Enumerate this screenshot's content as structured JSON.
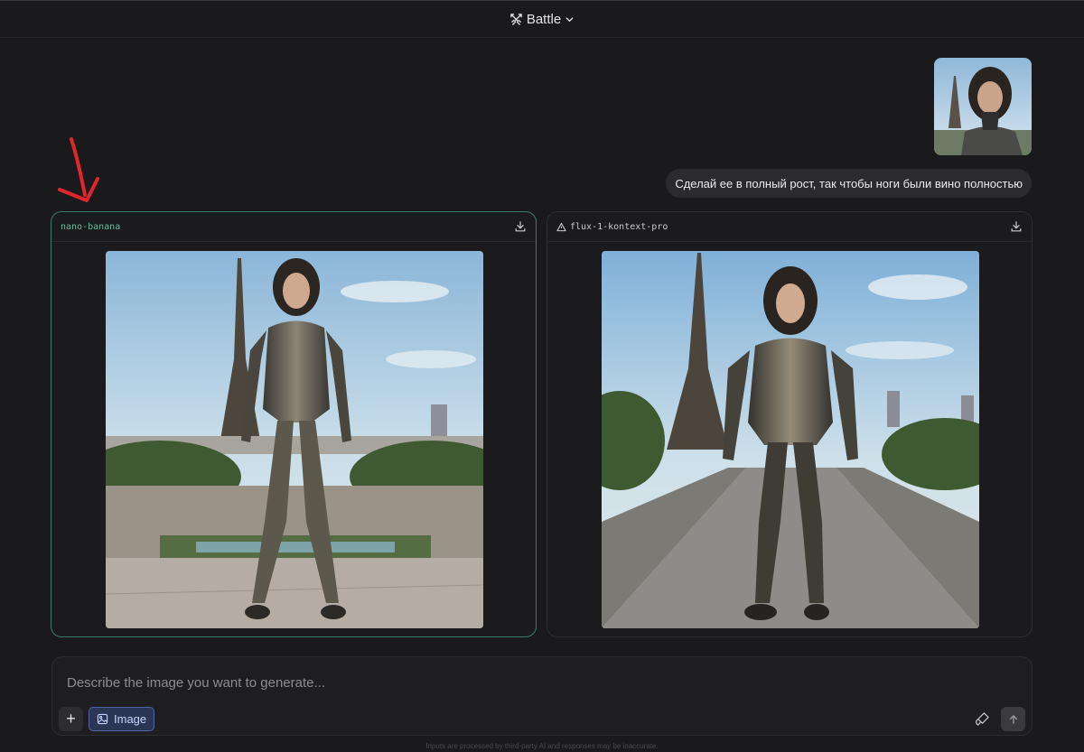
{
  "header": {
    "mode_label": "Battle",
    "mode_icon": "swords-icon"
  },
  "conversation": {
    "user_message": "Сделай ее в полный рост, так чтобы ноги были вино полностью"
  },
  "responses": [
    {
      "model": "nano-banana",
      "selected": true,
      "download_icon": "download-icon"
    },
    {
      "model": "flux-1-kontext-pro",
      "selected": false,
      "model_icon": "triangle-warning-icon",
      "download_icon": "download-icon"
    }
  ],
  "composer": {
    "placeholder": "Describe the image you want to generate...",
    "value": "",
    "add_label": "+",
    "image_mode_label": "Image"
  },
  "footer": {
    "disclaimer": "Inputs are processed by third-party AI and responses may be inaccurate."
  },
  "colors": {
    "background": "#1a1a1c",
    "selected_border": "#3f7a66",
    "selected_model_text": "#5fbf9a",
    "image_button_bg": "#2b3554",
    "annotation_arrow": "#e0262c"
  }
}
